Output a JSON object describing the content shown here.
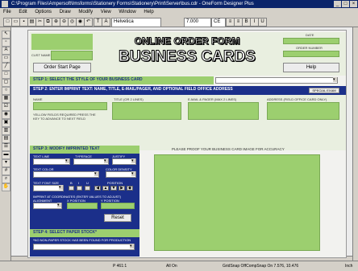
{
  "window": {
    "title": "C:\\Program Files\\Ampersoft\\Imsforms\\Stationery Forms\\Stationery\\Print\\Server\\bus.cdr - OneForm Designer Plus",
    "menu": [
      "File",
      "Edit",
      "Options",
      "Draw",
      "Modify",
      "View",
      "Window",
      "Help"
    ]
  },
  "toolbar": {
    "font": "Helvetica",
    "size": "7.000",
    "style": "CE"
  },
  "status": {
    "page": "P 461:1",
    "mode": "All On",
    "snap": "GridSnap OffCompSnap On  7.576, 10.476",
    "extra": "Inch"
  },
  "form": {
    "title_line1": "ONLINE ORDER FORM",
    "title_line2": "BUSINESS CARDS",
    "cust_name_label": "CUST NAME",
    "order_start_label": "Order Start Page",
    "date_label": "DATE",
    "order_number_label": "ORDER NUMBER",
    "help_label": "Help",
    "step1": "STEP 1:  SELECT THE STYLE OF YOUR BUSINESS CARD",
    "step2": "STEP 2:  ENTER IMPRINT TEXT: NAME, TITLE, E-MAIL/PAGER, AND OPTIONAL FIELD OFFICE ADDRESS",
    "special_label": "SPECIAL EXAM",
    "col_name": "NAME",
    "col_title": "TITLE (OR 2 LINES)",
    "col_email": "E-MAIL & PAGER (MAX 2 LINES)",
    "col_address": "ADDRESS (FIELD OFFICE CARD ONLY)",
    "note": "YELLOW FIELDS REQUIRED PRESS THE KEY TO ADVANCE TO NEXT FIELD",
    "step3": "STEP 3:  MODIFY IMPRINTED TEXT",
    "text_line_label": "TEXT LINE",
    "typeface_label": "TYPEFACE",
    "justify_label": "JUSTIFY",
    "text_color_label": "TEXT COLOR",
    "color_density_label": "COLOR DENSITY",
    "font_size_label": "TEXT FONT SIZE",
    "bold_label": "B",
    "italic_label": "I",
    "underline_label": "U",
    "position_label": "POSITION",
    "imprint_note": "IMPRINT AT COORDINATES (ENTER VALUES TO ADJUST)",
    "alignment_label": "ALIGNMENT",
    "x_position_label": "X POSITION",
    "y_position_label": "Y POSITION",
    "reset_label": "Reset",
    "step4": "STEP 4:  SELECT PAPER STOCK*",
    "paper_note": "*NO NON-PAPER STOCK HAS BEEN FOUND FOR PRODUCTION",
    "proof_caption": "PLEASE PROOF YOUR BUSINESS CARD IMAGE FOR ACCURACY"
  },
  "colors": {
    "green": "#9ccf6f",
    "navy": "#1b2f8a",
    "titlebar": "#0a246a"
  }
}
